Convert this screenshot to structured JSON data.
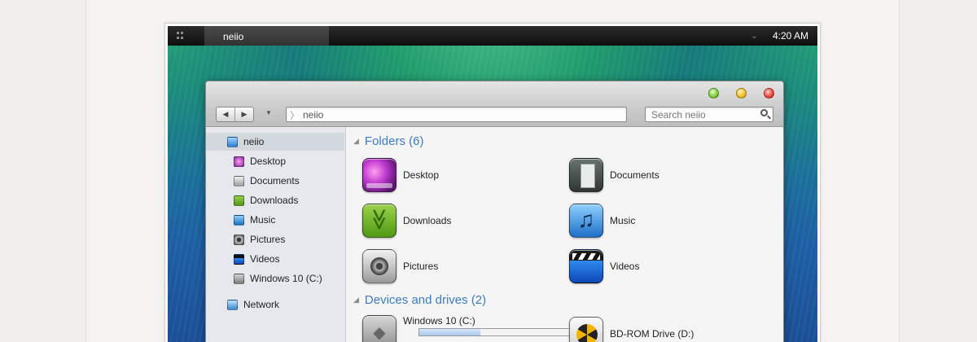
{
  "taskbar": {
    "app_name": "neiio",
    "clock": "4:20 AM",
    "menu_icon": "apps-grid-icon",
    "tray_icon": "chevron-down-icon"
  },
  "window": {
    "address_path": "neiio",
    "search_placeholder": "Search neiio",
    "back_icon": "back-arrow-icon",
    "forward_icon": "forward-arrow-icon",
    "window_controls": [
      "green",
      "yellow",
      "red"
    ]
  },
  "sidebar": {
    "items": [
      {
        "label": "neiio",
        "icon": "user-folder-icon"
      },
      {
        "label": "Desktop",
        "icon": "desktop-icon"
      },
      {
        "label": "Documents",
        "icon": "documents-icon"
      },
      {
        "label": "Downloads",
        "icon": "downloads-icon"
      },
      {
        "label": "Music",
        "icon": "music-icon"
      },
      {
        "label": "Pictures",
        "icon": "pictures-icon"
      },
      {
        "label": "Videos",
        "icon": "videos-icon"
      },
      {
        "label": "Windows 10 (C:)",
        "icon": "drive-icon"
      },
      {
        "label": "Network",
        "icon": "network-icon"
      }
    ]
  },
  "content": {
    "folders_header": "Folders (6)",
    "folders": [
      {
        "label": "Desktop",
        "icon": "desktop-icon"
      },
      {
        "label": "Documents",
        "icon": "documents-icon"
      },
      {
        "label": "Downloads",
        "icon": "downloads-icon"
      },
      {
        "label": "Music",
        "icon": "music-icon"
      },
      {
        "label": "Pictures",
        "icon": "pictures-icon"
      },
      {
        "label": "Videos",
        "icon": "videos-icon"
      }
    ],
    "devices_header": "Devices and drives (2)",
    "devices": [
      {
        "label": "Windows 10 (C:)",
        "icon": "drive-icon",
        "used_fraction": 0.4
      },
      {
        "label": "BD-ROM Drive (D:)",
        "icon": "bd-rom-icon"
      }
    ]
  },
  "colors": {
    "accent": "#3b7bc8",
    "sidebar_bg": "#e6e8ed",
    "topbar_bg": "#1a1a1a"
  }
}
